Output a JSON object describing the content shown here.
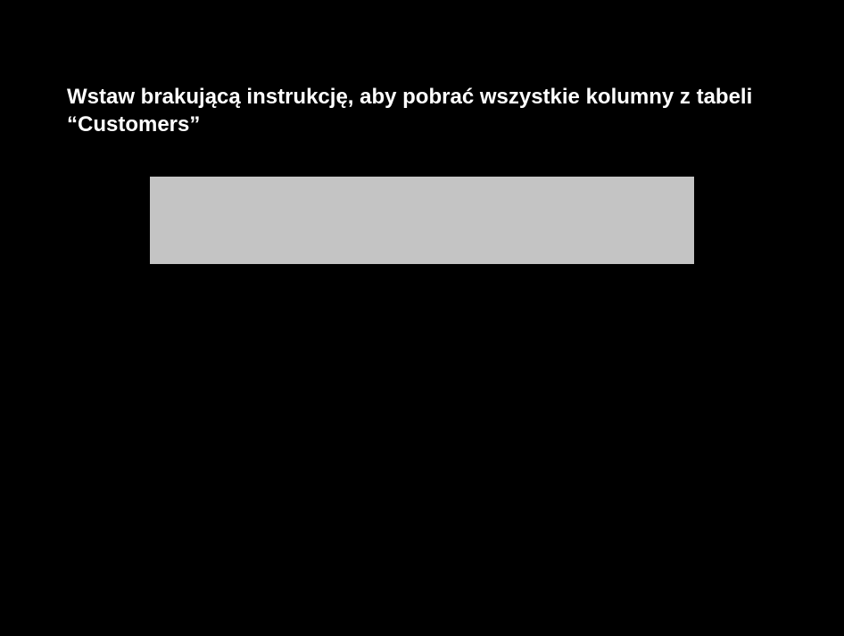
{
  "exercise": {
    "question": "Wstaw brakującą instrukcję, aby pobrać wszystkie kolumny z tabeli “Customers”",
    "code_box": {
      "content": ""
    }
  },
  "colors": {
    "background": "#000000",
    "text": "#ffffff",
    "code_box": "#c4c4c4"
  }
}
